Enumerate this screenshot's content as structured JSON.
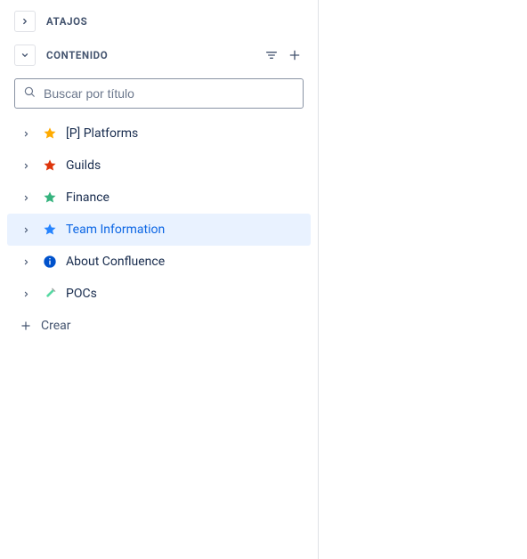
{
  "sidebar": {
    "sections": {
      "atajos_label": "ATAJOS",
      "contenido_label": "CONTENIDO"
    },
    "search_placeholder": "Buscar por título",
    "tree": {
      "items": [
        {
          "label": "[P] Platforms",
          "icon": "star",
          "icon_color": "#FFAB00",
          "selected": false
        },
        {
          "label": "Guilds",
          "icon": "star",
          "icon_color": "#DE350B",
          "selected": false
        },
        {
          "label": "Finance",
          "icon": "star",
          "icon_color": "#36B37E",
          "selected": false
        },
        {
          "label": "Team Information",
          "icon": "star",
          "icon_color": "#2684FF",
          "selected": true
        },
        {
          "label": "About Confluence",
          "icon": "info",
          "icon_color": "#0052CC",
          "selected": false
        },
        {
          "label": "POCs",
          "icon": "test-tube",
          "icon_color": "#57D9A3",
          "selected": false
        }
      ]
    },
    "create_label": "Crear"
  }
}
